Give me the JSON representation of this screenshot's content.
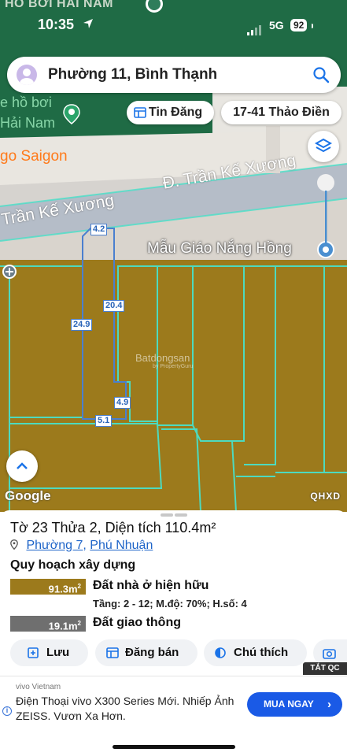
{
  "status_bar": {
    "time": "10:35",
    "network": "5G",
    "battery": "92"
  },
  "map": {
    "top_poi": "HỒ BƠI HẢI NAM",
    "poi_hoboi_line1": "e hồ bơi",
    "poi_hoboi_line2": "Hải Nam",
    "poi_saigon": "go Saigon",
    "street_label_1": "Đ. Trần Kế Xương",
    "street_label_2": "Trần Kế Xương",
    "poi_maugiao": "Mẫu Giáo Nắng Hồng",
    "dimensions": [
      "4.2",
      "20.4",
      "24.9",
      "4.9",
      "5.1"
    ],
    "watermark": "Batdongsan",
    "watermark_sub": "by PropertyGuru",
    "google_logo": "Google",
    "layer_code": "QHXD"
  },
  "search": {
    "address": "Phường 11, Bình Thạnh"
  },
  "chips": {
    "tin_dang": "Tin Đăng",
    "location": "17-41 Thảo Điền"
  },
  "parcel": {
    "title": "Tờ 23 Thửa 2, Diện tích 110.4m²",
    "ward": "Phường 7",
    "separator": ",",
    "district": "Phú Nhuận",
    "section_title": "Quy hoạch xây dựng",
    "zones": [
      {
        "area": "91.3m",
        "sup": "2",
        "label": "Đất nhà ở hiện hữu",
        "detail": "Tầng: 2 - 12; M.độ: 70%; H.số: 4",
        "color": "#9c7a1c"
      },
      {
        "area": "19.1m",
        "sup": "2",
        "label": "Đất giao thông",
        "color": "#6f6f6f"
      }
    ]
  },
  "actions": {
    "save": "Lưu",
    "post": "Đăng bán",
    "legend": "Chú thích"
  },
  "ad": {
    "close_label": "TẮT QC",
    "brand": "vivo Vietnam",
    "text": "Điện Thoại vivo X300 Series Mới. Nhiếp Ảnh ZEISS. Vươn Xa Hơn.",
    "cta": "MUA NGAY",
    "info_icon": "i",
    "cta_color": "#1a5ae6"
  }
}
